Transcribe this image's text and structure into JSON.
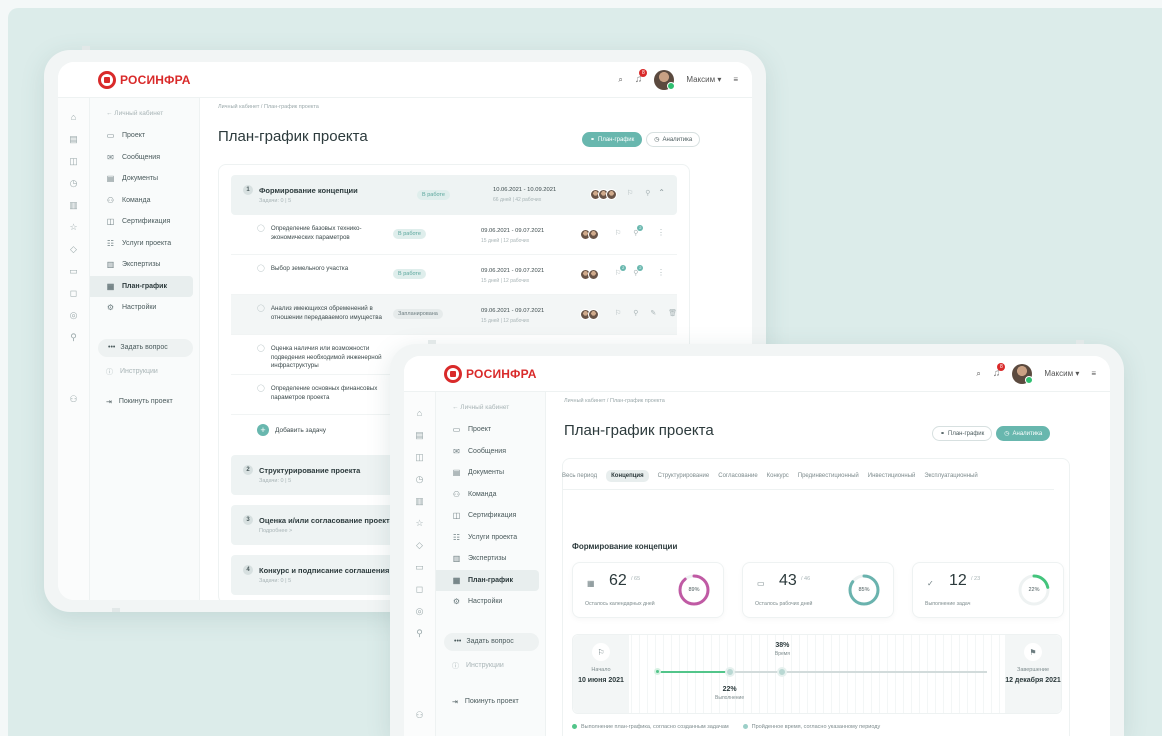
{
  "app": {
    "logo": "РОСИНФРА",
    "user": "Максим ▾"
  },
  "sidebar": {
    "back": "← Личный кабинет",
    "items": [
      {
        "label": "Проект",
        "icon": "briefcase-icon",
        "glyph": "▭"
      },
      {
        "label": "Сообщения",
        "icon": "mail-icon",
        "glyph": "✉"
      },
      {
        "label": "Документы",
        "icon": "document-icon",
        "glyph": "▤"
      },
      {
        "label": "Команда",
        "icon": "team-icon",
        "glyph": "⚇"
      },
      {
        "label": "Сертификация",
        "icon": "certificate-icon",
        "glyph": "◫"
      },
      {
        "label": "Услуги проекта",
        "icon": "services-icon",
        "glyph": "☷"
      },
      {
        "label": "Экспертизы",
        "icon": "expertise-icon",
        "glyph": "▥"
      },
      {
        "label": "План-график",
        "icon": "calendar-icon",
        "glyph": "▦"
      },
      {
        "label": "Настройки",
        "icon": "settings-icon",
        "glyph": "⚙"
      }
    ],
    "ask": "Задать вопрос",
    "instructions": "Инструкции",
    "leave": "Покинуть проект"
  },
  "breadcrumb": {
    "parent": "Личный кабинет",
    "sep": "/",
    "current": "План-график проекта"
  },
  "page_title": "План-график проекта",
  "toggle": {
    "plan": "План-график",
    "analytics": "Аналитика"
  },
  "stages": [
    {
      "num": "1",
      "name": "Формирование концепции",
      "sub": "Задачи: 0 | 5",
      "status": "В работе",
      "dates": "10.06.2021 - 10.09.2021",
      "days": "66 дней | 42 рабочих"
    },
    {
      "num": "2",
      "name": "Структурирование проекта",
      "sub": "Задачи: 0 | 5"
    },
    {
      "num": "3",
      "name": "Оценка и/или согласование проекта",
      "sub": "Подробнее >"
    },
    {
      "num": "4",
      "name": "Конкурс и подписание соглашения",
      "sub": "Задачи: 0 | 5"
    }
  ],
  "tasks": [
    {
      "name": "Определение базовых технико-экономических параметров",
      "status": "В работе",
      "dates": "09.06.2021 - 09.07.2021",
      "days": "15 дней | 12 рабочих",
      "badge1": "",
      "badge2": "2"
    },
    {
      "name": "Выбор земельного участка",
      "status": "В работе",
      "dates": "09.06.2021 - 09.07.2021",
      "days": "15 дней | 12 рабочих",
      "badge1": "2",
      "badge2": "2"
    },
    {
      "name": "Анализ имеющихся обременений в отношении передаваемого имущества",
      "status": "Запланирована",
      "dates": "09.06.2021 - 09.07.2021",
      "days": "15 дней | 12 рабочих"
    },
    {
      "name": "Оценка наличия или возможности подведения необходимой инженерной инфраструктуры"
    },
    {
      "name": "Определение основных финансовых параметров проекта"
    }
  ],
  "add_task": "Добавить задачу",
  "analytics": {
    "tabs": [
      "Весь период",
      "Концепция",
      "Структурирование",
      "Согласование",
      "Конкурс",
      "Прединвестиционный",
      "Инвестиционный",
      "Эксплуатационный"
    ],
    "active_tab": 1,
    "section_title": "Формирование концепции",
    "cards": [
      {
        "value": "62",
        "of": "/ 65",
        "label": "Осталось календарных дней",
        "pct": 89,
        "pct_label": "89%",
        "color": "#c05aa4",
        "icon": "calendar-icon",
        "glyph": "▦"
      },
      {
        "value": "43",
        "of": "/ 46",
        "label": "Осталось рабочих дней",
        "pct": 85,
        "pct_label": "85%",
        "color": "#6ab3ae",
        "icon": "briefcase-icon",
        "glyph": "▭"
      },
      {
        "value": "12",
        "of": "/ 23",
        "label": "Выполнение задач",
        "pct": 22,
        "pct_label": "22%",
        "color": "#43c47c",
        "icon": "check-icon",
        "glyph": "✓"
      }
    ],
    "timeline": {
      "start_label": "Начало",
      "start_date": "10 июня 2021",
      "end_label": "Завершение",
      "end_date": "12 декабря 2021",
      "time_pct": "38%",
      "time_label": "Время",
      "done_pct": "22%",
      "done_label": "Выполнение",
      "time_fraction": 0.38,
      "done_fraction": 0.22
    },
    "legend": [
      "Выполнение план-графика, согласно созданным задачам",
      "Пройденное время, согласно указанному периоду"
    ]
  },
  "colors": {
    "accent": "#68b7ae",
    "brand": "#d92a2a",
    "progress": "#52c58a"
  }
}
